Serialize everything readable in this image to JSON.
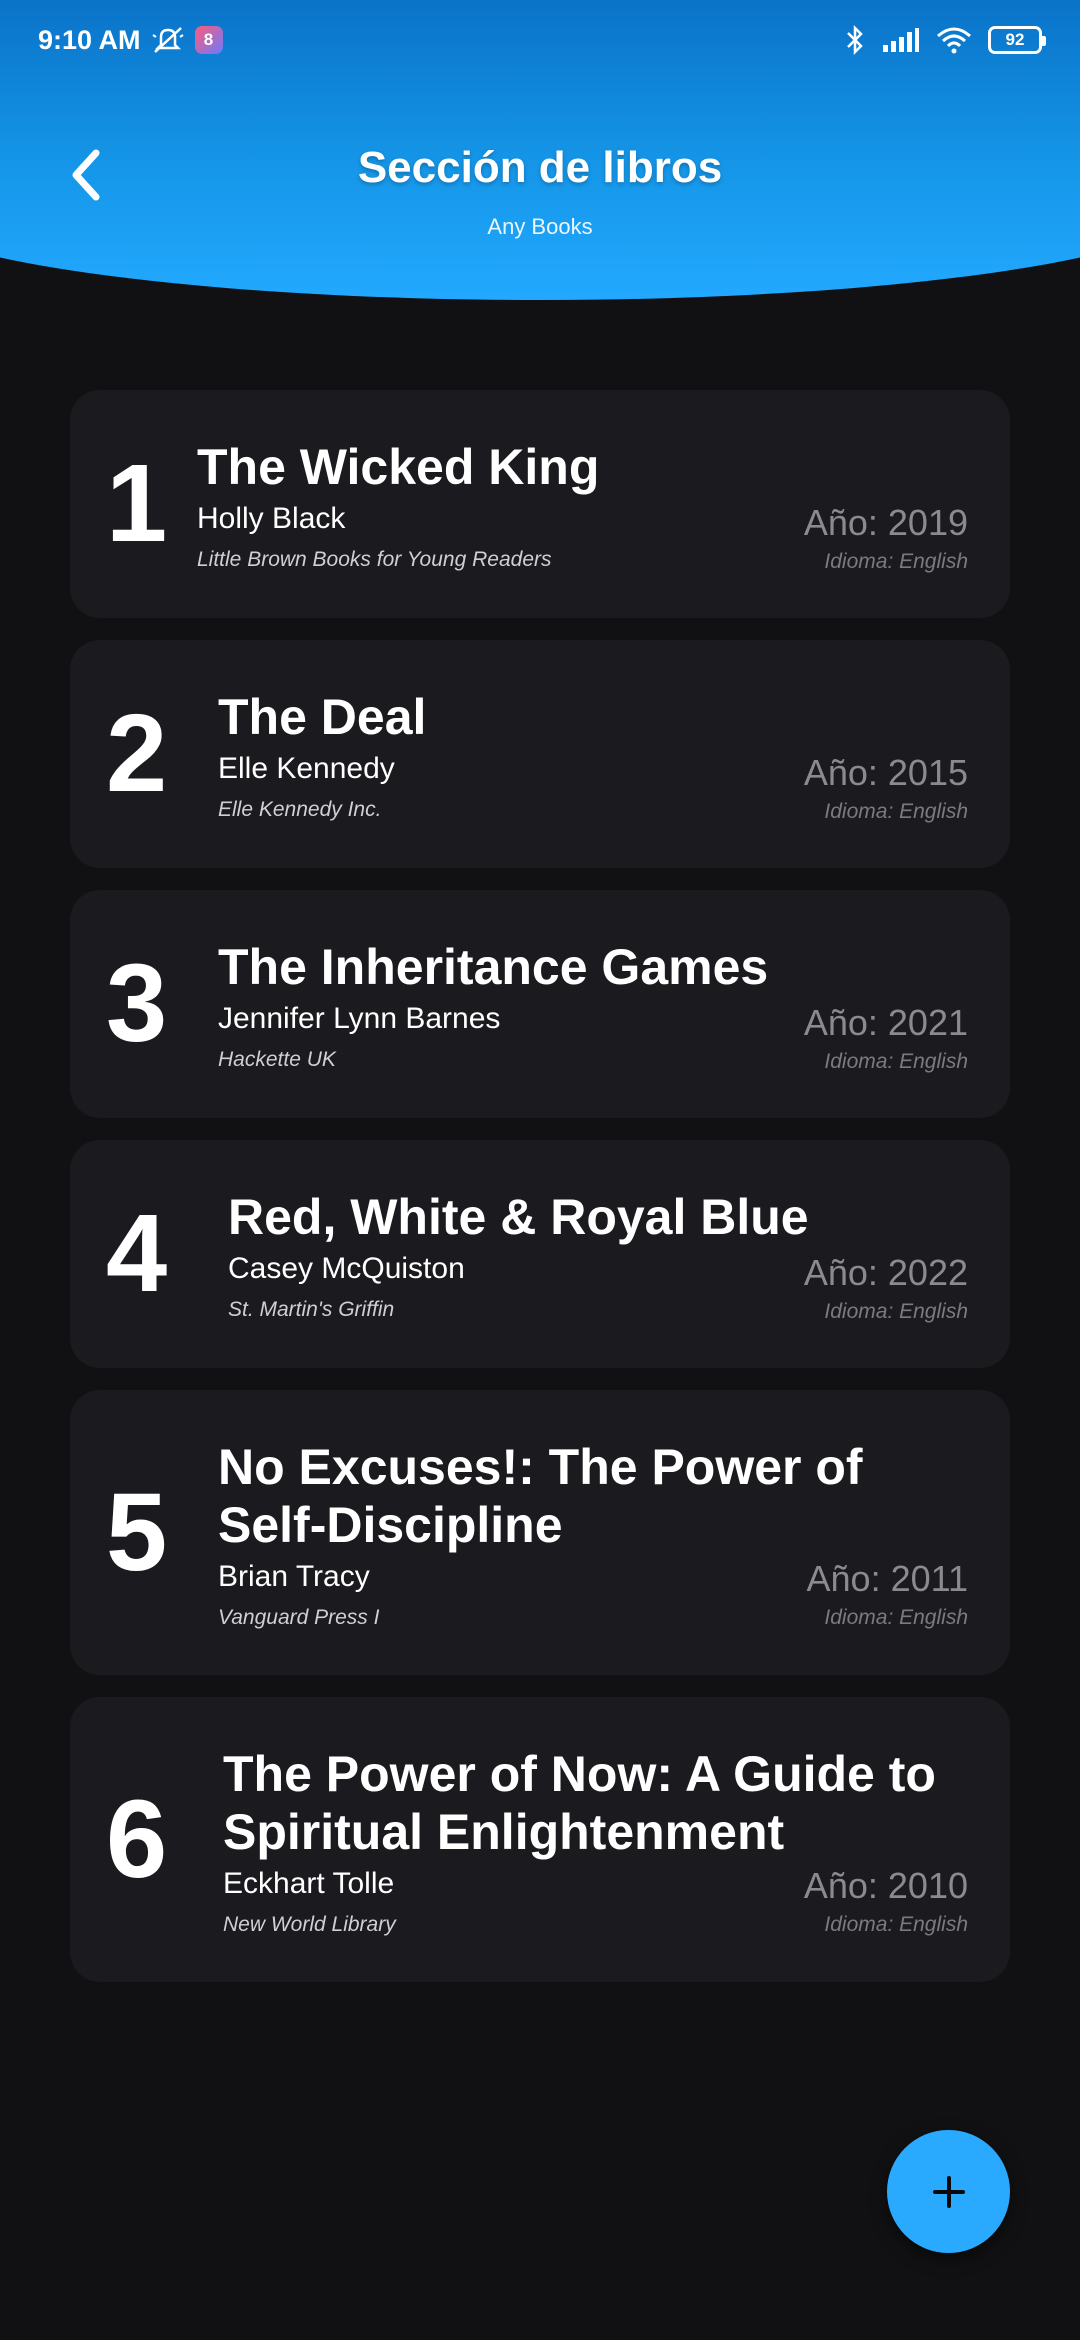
{
  "status_bar": {
    "time": "9:10 AM",
    "battery": "92",
    "icons": [
      "mute-icon",
      "app-badge-icon",
      "bluetooth-icon",
      "signal-icon",
      "wifi-icon",
      "battery-icon"
    ]
  },
  "header": {
    "title": "Sección de libros",
    "subtitle": "Any Books",
    "gradient": [
      "#0a73c8",
      "#22a9ff"
    ]
  },
  "books": [
    {
      "rank": "1",
      "title": "The Wicked King",
      "author": "Holly Black",
      "publisher": "Little Brown Books for Young Readers",
      "year": "Año: 2019",
      "language": "Idioma: English"
    },
    {
      "rank": "2",
      "title": "The Deal",
      "author": "Elle Kennedy",
      "publisher": "Elle Kennedy Inc.",
      "year": "Año: 2015",
      "language": "Idioma: English"
    },
    {
      "rank": "3",
      "title": "The Inheritance Games",
      "author": "Jennifer Lynn Barnes",
      "publisher": "Hackette UK",
      "year": "Año: 2021",
      "language": "Idioma: English"
    },
    {
      "rank": "4",
      "title": "Red, White & Royal Blue",
      "author": "Casey McQuiston",
      "publisher": "St. Martin's Griffin",
      "year": "Año: 2022",
      "language": "Idioma: English"
    },
    {
      "rank": "5",
      "title_line1": "No Excuses!: The Power of",
      "title_line2": "Self-Discipline",
      "author": "Brian Tracy",
      "publisher": "Vanguard Press I",
      "year": "Año: 2011",
      "language": "Idioma: English"
    },
    {
      "rank": "6",
      "title_line1": "The Power of Now: A Guide to",
      "title_line2": "Spiritual Enlightenment",
      "author": "Eckhart Tolle",
      "publisher": "New World Library",
      "year": "Año: 2010",
      "language": "Idioma: English"
    }
  ],
  "fab": {
    "icon": "plus-icon"
  },
  "colors": {
    "background": "#111113",
    "card": "#1b1b1f",
    "accent": "#29aaff",
    "muted_text": "#8a8a90"
  }
}
